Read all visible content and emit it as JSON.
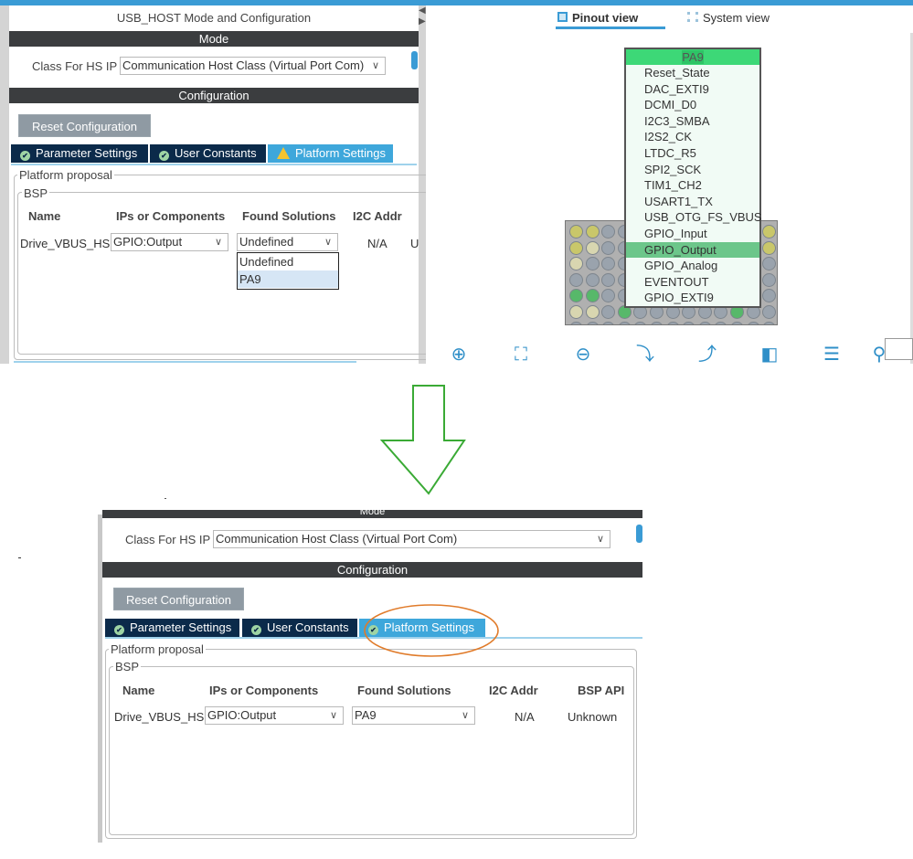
{
  "before": {
    "panel_title": "USB_HOST Mode and Configuration",
    "mode_header": "Mode",
    "class_label": "Class For HS IP",
    "class_value": "Communication Host Class (Virtual Port Com)",
    "config_header": "Configuration",
    "reset_button": "Reset Configuration",
    "tabs": [
      {
        "label": "Parameter Settings",
        "icon": "check-circle-icon"
      },
      {
        "label": "User Constants",
        "icon": "check-circle-icon"
      },
      {
        "label": "Platform Settings",
        "icon": "warning-icon",
        "active": true
      }
    ],
    "platform_proposal": "Platform proposal",
    "bsp": "BSP",
    "columns": [
      "Name",
      "IPs or Components",
      "Found Solutions",
      "I2C Addr",
      "U"
    ],
    "row": {
      "name": "Drive_VBUS_HS",
      "ip": "GPIO:Output",
      "solution": "Undefined",
      "i2c": "N/A"
    },
    "solution_options": [
      "Undefined",
      "PA9"
    ],
    "highlighted_option": "PA9"
  },
  "pinout": {
    "tabs": [
      {
        "label": "Pinout view",
        "icon": "chip-icon",
        "active": true
      },
      {
        "label": "System view",
        "icon": "grid-icon"
      }
    ],
    "pin_menu": {
      "title": "PA9",
      "items": [
        "Reset_State",
        "DAC_EXTI9",
        "DCMI_D0",
        "I2C3_SMBA",
        "I2S2_CK",
        "LTDC_R5",
        "SPI2_SCK",
        "TIM1_CH2",
        "USART1_TX",
        "USB_OTG_FS_VBUS",
        "GPIO_Input",
        "GPIO_Output",
        "GPIO_Analog",
        "EVENTOUT",
        "GPIO_EXTI9"
      ],
      "selected": "GPIO_Output"
    },
    "toolbar": [
      "zoom-in-icon",
      "fit-screen-icon",
      "zoom-out-icon",
      "rotate-right-icon",
      "rotate-left-icon",
      "flip-vertical-icon",
      "flip-horizontal-icon",
      "search-icon"
    ]
  },
  "after": {
    "mode_header": "Mode",
    "class_label": "Class For HS IP",
    "class_value": "Communication Host Class (Virtual Port Com)",
    "config_header": "Configuration",
    "reset_button": "Reset Configuration",
    "tabs": [
      {
        "label": "Parameter Settings",
        "icon": "check-circle-icon"
      },
      {
        "label": "User Constants",
        "icon": "check-circle-icon"
      },
      {
        "label": "Platform Settings",
        "icon": "check-circle-icon",
        "active": true
      }
    ],
    "platform_proposal": "Platform proposal",
    "bsp": "BSP",
    "columns": [
      "Name",
      "IPs or Components",
      "Found Solutions",
      "I2C Addr",
      "BSP API"
    ],
    "row": {
      "name": "Drive_VBUS_HS",
      "ip": "GPIO:Output",
      "solution": "PA9",
      "i2c": "N/A",
      "api": "Unknown"
    }
  },
  "colors": {
    "accent": "#3ea7db",
    "tab_dark": "#0b2a4a",
    "header_bar": "#3b3d3f",
    "menu_green": "#3dd877",
    "arrow": "#3aaa35",
    "highlight_ellipse": "#e07b2a"
  }
}
